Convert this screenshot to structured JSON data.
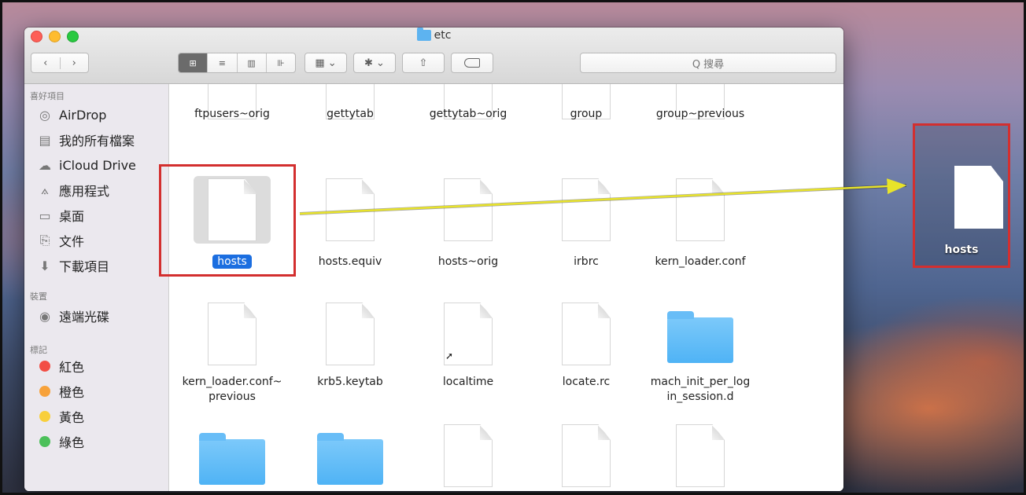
{
  "window": {
    "title": "etc"
  },
  "toolbar": {
    "back": "‹",
    "forward": "›",
    "views": [
      "⊞",
      "≡",
      "▥",
      "⊪"
    ],
    "arrange": "▦ ⌄",
    "action": "✱ ⌄",
    "share": "⇧",
    "search_placeholder": "Q 搜尋"
  },
  "sidebar": {
    "favorites_header": "喜好項目",
    "favorites": [
      {
        "label": "AirDrop",
        "icon": "airdrop-icon",
        "glyph": "◎"
      },
      {
        "label": "我的所有檔案",
        "icon": "all-files-icon",
        "glyph": "▤"
      },
      {
        "label": "iCloud Drive",
        "icon": "cloud-icon",
        "glyph": "☁"
      },
      {
        "label": "應用程式",
        "icon": "applications-icon",
        "glyph": "⟑"
      },
      {
        "label": "桌面",
        "icon": "desktop-icon",
        "glyph": "▭"
      },
      {
        "label": "文件",
        "icon": "documents-icon",
        "glyph": "⎘"
      },
      {
        "label": "下載項目",
        "icon": "downloads-icon",
        "glyph": "⬇"
      }
    ],
    "devices_header": "裝置",
    "devices": [
      {
        "label": "遠端光碟",
        "icon": "remote-disc-icon",
        "glyph": "◉"
      }
    ],
    "tags_header": "標記",
    "tags": [
      {
        "label": "紅色",
        "color": "#f24e45"
      },
      {
        "label": "橙色",
        "color": "#f7a23b"
      },
      {
        "label": "黃色",
        "color": "#f8cf3c"
      },
      {
        "label": "綠色",
        "color": "#4cc05a"
      }
    ]
  },
  "files": {
    "row0": [
      "ftpusers~orig",
      "gettytab",
      "gettytab~orig",
      "group",
      "group~previous"
    ],
    "row1": [
      "hosts",
      "hosts.equiv",
      "hosts~orig",
      "irbrc",
      "kern_loader.conf"
    ],
    "row2": [
      "kern_loader.conf~\nprevious",
      "krb5.keytab",
      "localtime",
      "locate.rc",
      "mach_init_per_log\nin_session.d"
    ]
  },
  "drag_copy": {
    "label": "hosts"
  },
  "colors": {
    "highlight": "#d32f2f",
    "arrow": "#e8e32a",
    "selection": "#1b6ee0"
  }
}
